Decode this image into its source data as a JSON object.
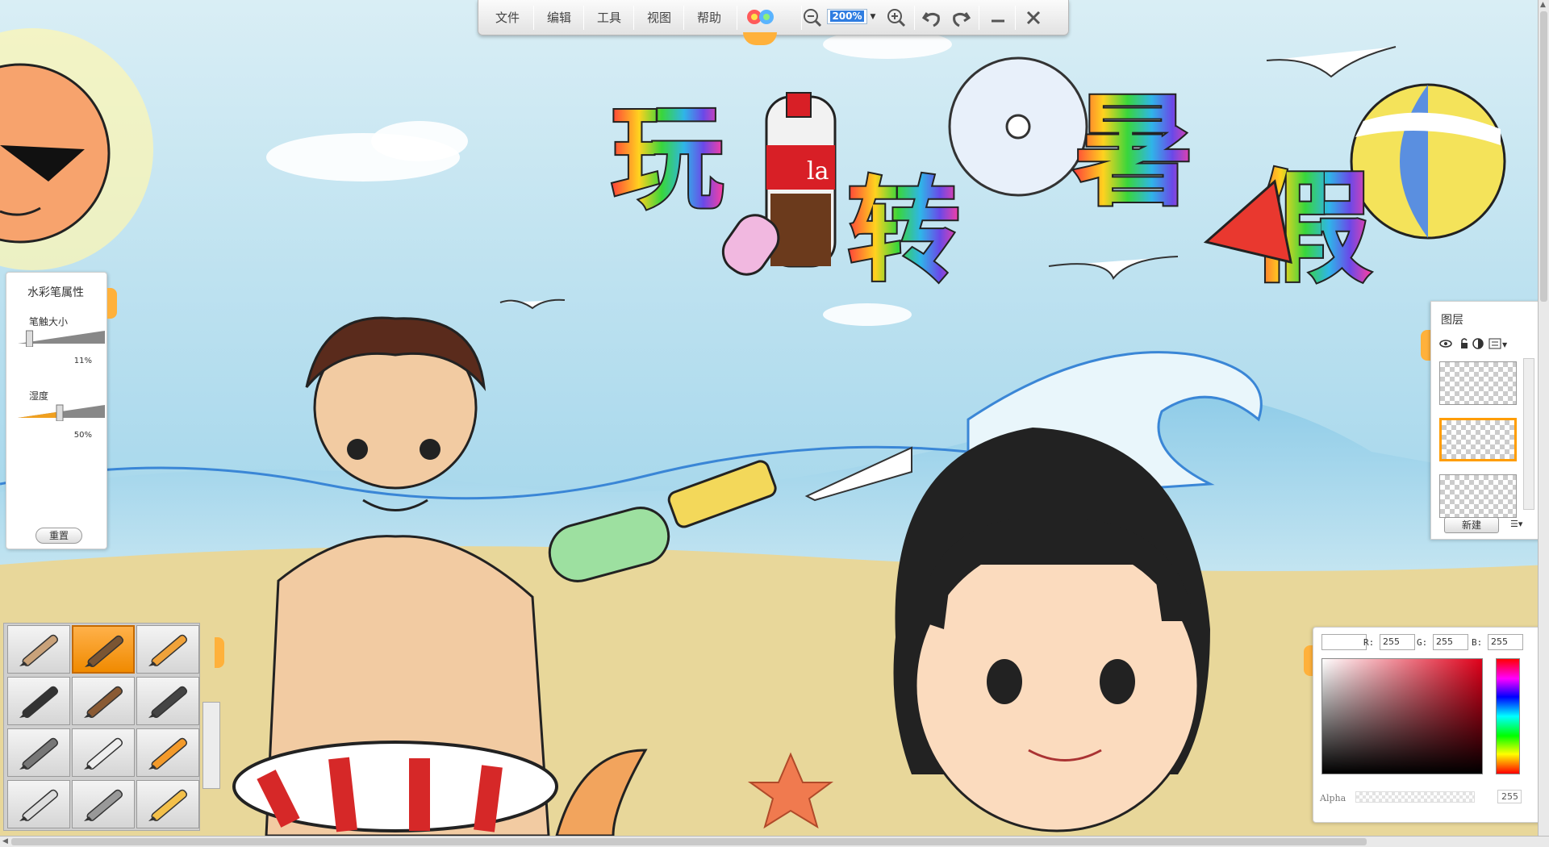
{
  "menu": {
    "items": [
      "文件",
      "编辑",
      "工具",
      "视图",
      "帮助"
    ],
    "zoom": "200%"
  },
  "toolbar_icons": [
    "logo-icon",
    "zoom-out-icon",
    "zoom-in-icon",
    "undo-icon",
    "redo-icon",
    "minimize-icon",
    "close-icon"
  ],
  "brush_props": {
    "title": "水彩笔属性",
    "size_label": "笔触大小",
    "size_value": "11%",
    "size_level": 0.11,
    "wet_label": "湿度",
    "wet_value": "50%",
    "wet_level": 0.5,
    "reset": "重置"
  },
  "brushes": {
    "items": [
      "pencil-brush-icon",
      "watercolor-brush-icon",
      "crayon-brush-icon",
      "fountain-pen-icon",
      "flat-brush-icon",
      "calligraphy-brush-icon",
      "airbrush-icon",
      "palette-knife-icon",
      "paint-roller-icon",
      "eraser-icon",
      "smudge-tool-icon",
      "marker-icon"
    ],
    "active_index": 1
  },
  "layers": {
    "title": "图层",
    "new_button": "新建",
    "count": 3,
    "selected_index": 1
  },
  "color": {
    "r_label": "R:",
    "r": "255",
    "g_label": "G:",
    "g": "255",
    "b_label": "B:",
    "b": "255",
    "alpha_label": "Alpha",
    "alpha": "255"
  },
  "artwork": {
    "title_chars": [
      "玩",
      "转",
      "暑",
      "假"
    ],
    "bottle_text": "la"
  },
  "colors": {
    "accent": "#ffb13b",
    "sky": "#bfe3f1",
    "sand": "#e8d79a"
  }
}
